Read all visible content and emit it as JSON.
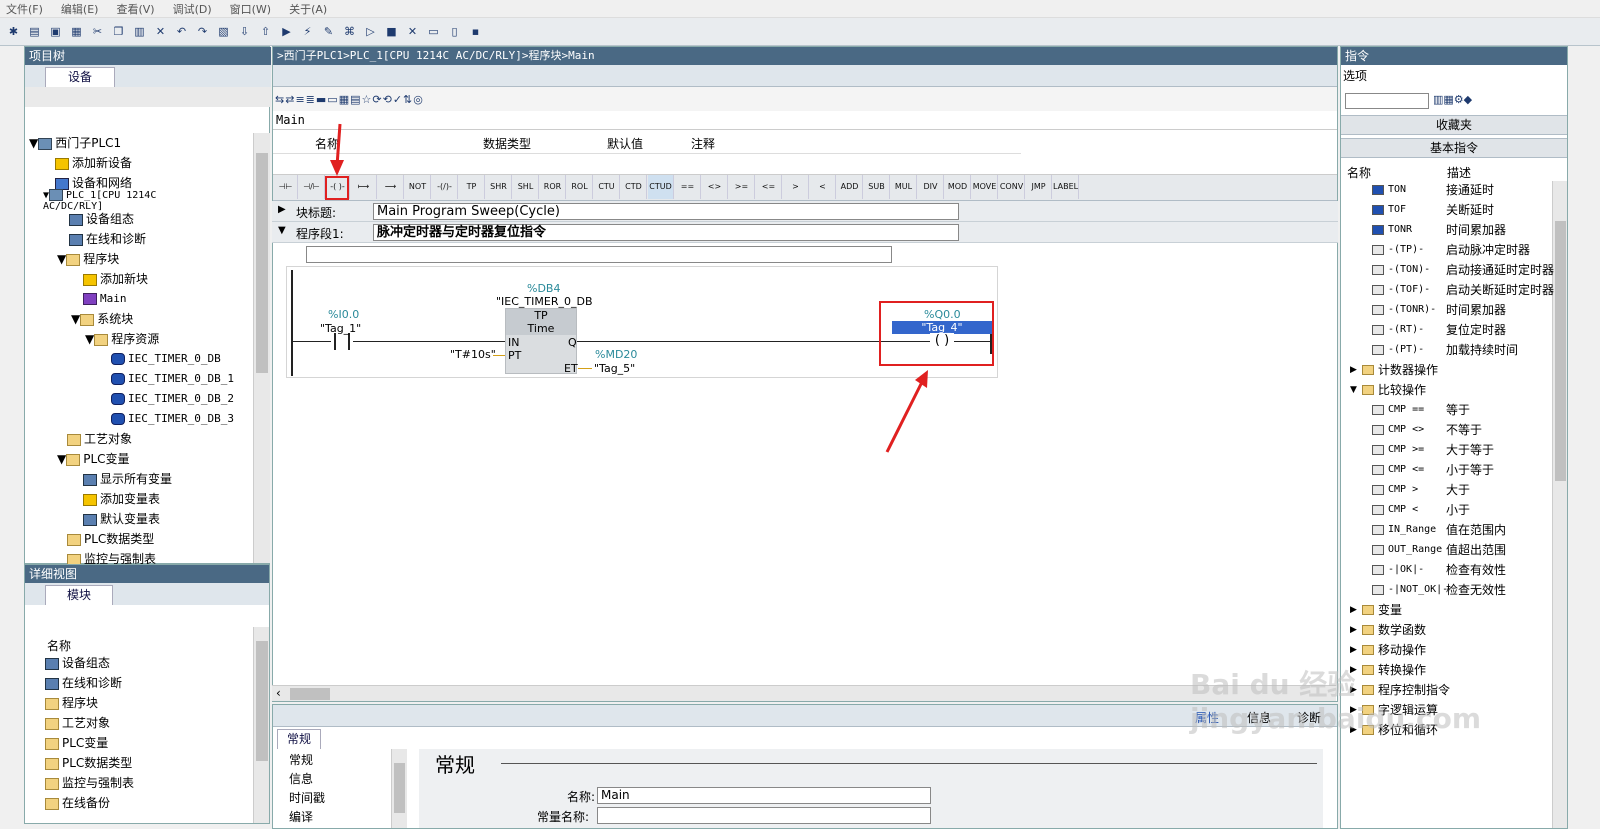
{
  "menu": [
    "文件(F)",
    "编辑(E)",
    "查看(V)",
    "调试(D)",
    "窗口(W)",
    "关于(A)"
  ],
  "project_tree": {
    "title": "项目树",
    "tab": "设备",
    "items": [
      {
        "label": "西门子PLC1"
      },
      {
        "label": "添加新设备"
      },
      {
        "label": "设备和网络"
      },
      {
        "label": "PLC_1[CPU 1214C AC/DC/RLY]"
      },
      {
        "label": "设备组态"
      },
      {
        "label": "在线和诊断"
      },
      {
        "label": "程序块"
      },
      {
        "label": "添加新块"
      },
      {
        "label": "Main"
      },
      {
        "label": "系统块"
      },
      {
        "label": "程序资源"
      },
      {
        "label": "IEC_TIMER_0_DB"
      },
      {
        "label": "IEC_TIMER_0_DB_1"
      },
      {
        "label": "IEC_TIMER_0_DB_2"
      },
      {
        "label": "IEC_TIMER_0_DB_3"
      },
      {
        "label": "工艺对象"
      },
      {
        "label": "PLC变量"
      },
      {
        "label": "显示所有变量"
      },
      {
        "label": "添加变量表"
      },
      {
        "label": "默认变量表"
      },
      {
        "label": "PLC数据类型"
      },
      {
        "label": "监控与强制表"
      }
    ]
  },
  "detail_view": {
    "title": "详细视图",
    "tab": "模块",
    "header": "名称",
    "items": [
      "设备组态",
      "在线和诊断",
      "程序块",
      "工艺对象",
      "PLC变量",
      "PLC数据类型",
      "监控与强制表",
      "在线备份"
    ]
  },
  "editor": {
    "breadcrumb": ">西门子PLC1>PLC_1[CPU 1214C AC/DC/RLY]>程序块>Main",
    "block_name": "Main",
    "interface_cols": [
      "名称",
      "数据类型",
      "默认值",
      "注释"
    ],
    "ladder_buttons": [
      "⊣⊢",
      "⊣/⊢",
      "-( )-",
      "⟼",
      "⟶",
      "NOT",
      "-(/)-",
      "TP",
      "SHR",
      "SHL",
      "ROR",
      "ROL",
      "CTU",
      "CTD",
      "CTUD",
      "==",
      "<>",
      ">=",
      "<=",
      ">",
      "<",
      "ADD",
      "SUB",
      "MUL",
      "DIV",
      "MOD",
      "MOVE",
      "CONV",
      "JMP",
      "LABEL"
    ],
    "block_title_label": "块标题:",
    "block_title_value": "Main Program Sweep(Cycle)",
    "network_label": "程序段1:",
    "network_title": "脉冲定时器与定时器复位指令",
    "network": {
      "contact_addr": "%I0.0",
      "contact_tag": "\"Tag_1\"",
      "db_addr": "%DB4",
      "db_name": "\"IEC_TIMER_0_DB",
      "box_type": "TP",
      "box_sub": "Time",
      "pin_in": "IN",
      "pin_pt": "PT",
      "pin_q": "Q",
      "pin_et": "ET",
      "pt_value": "\"T#10s\"",
      "et_addr": "%MD20",
      "et_tag": "\"Tag_5\"",
      "coil_addr": "%Q0.0",
      "coil_tag": "\"Tag_4\""
    }
  },
  "properties": {
    "tabs": [
      "属性",
      "信息",
      "诊断"
    ],
    "general_tab": "常规",
    "nav_items": [
      "常规",
      "信息",
      "时间戳",
      "编译"
    ],
    "section_title": "常规",
    "name_label": "名称:",
    "name_value": "Main",
    "constant_label": "常量名称:"
  },
  "instructions": {
    "title": "指令",
    "options": "选项",
    "favorites": "收藏夹",
    "basic": "基本指令",
    "col_name": "名称",
    "col_desc": "描述",
    "rows": [
      {
        "name": "TON",
        "desc": "接通延时"
      },
      {
        "name": "TOF",
        "desc": "关断延时"
      },
      {
        "name": "TONR",
        "desc": "时间累加器"
      },
      {
        "name": "-(TP)-",
        "desc": "启动脉冲定时器"
      },
      {
        "name": "-(TON)-",
        "desc": "启动接通延时定时器"
      },
      {
        "name": "-(TOF)-",
        "desc": "启动关断延时定时器"
      },
      {
        "name": "-(TONR)-",
        "desc": "时间累加器"
      },
      {
        "name": "-(RT)-",
        "desc": "复位定时器"
      },
      {
        "name": "-(PT)-",
        "desc": "加载持续时间"
      },
      {
        "name": "计数器操作",
        "desc": ""
      },
      {
        "name": "比较操作",
        "desc": ""
      },
      {
        "name": "CMP ==",
        "desc": "等于"
      },
      {
        "name": "CMP <>",
        "desc": "不等于"
      },
      {
        "name": "CMP >=",
        "desc": "大于等于"
      },
      {
        "name": "CMP <=",
        "desc": "小于等于"
      },
      {
        "name": "CMP >",
        "desc": "大于"
      },
      {
        "name": "CMP <",
        "desc": "小于"
      },
      {
        "name": "IN_Range",
        "desc": "值在范围内"
      },
      {
        "name": "OUT_Range",
        "desc": "值超出范围"
      },
      {
        "name": "-|OK|-",
        "desc": "检查有效性"
      },
      {
        "name": "-|NOT_OK|-",
        "desc": "检查无效性"
      },
      {
        "name": "变量",
        "desc": ""
      },
      {
        "name": "数学函数",
        "desc": ""
      },
      {
        "name": "移动操作",
        "desc": ""
      },
      {
        "name": "转换操作",
        "desc": ""
      },
      {
        "name": "程序控制指令",
        "desc": ""
      },
      {
        "name": "字逻辑运算",
        "desc": ""
      },
      {
        "name": "移位和循环",
        "desc": ""
      }
    ]
  },
  "watermark": "Bai du 经验 jingyan.baidu.com",
  "colors": {
    "panel_title": "#4a6984",
    "highlight_red": "#e02020",
    "selected_tag": "#3366cc",
    "addr_teal": "#2a8a9a"
  }
}
